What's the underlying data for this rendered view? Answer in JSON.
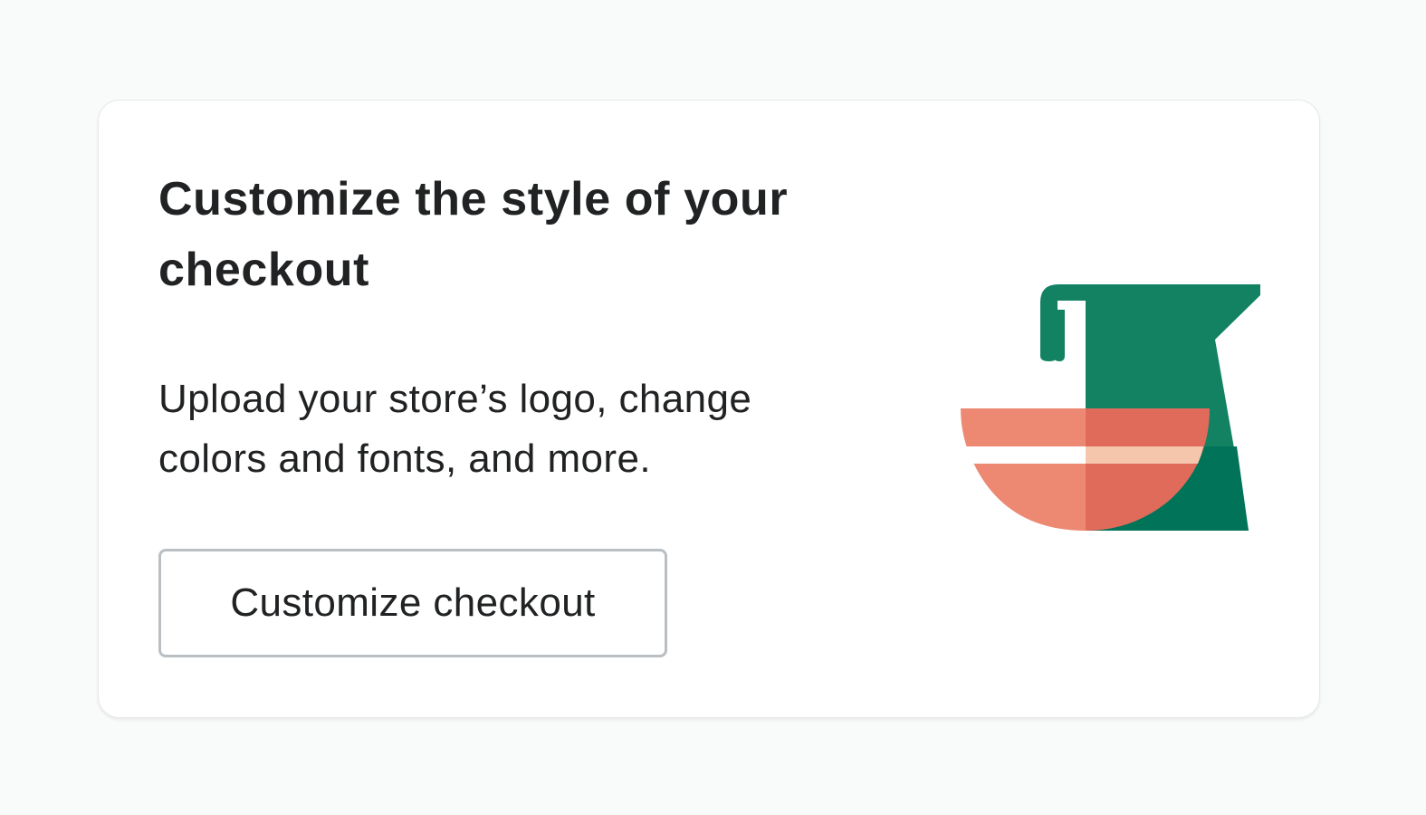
{
  "card": {
    "title": "Customize the style of your checkout",
    "description": "Upload your store’s logo, change colors and fonts, and more.",
    "button_label": "Customize checkout"
  },
  "illustration": {
    "icon": "mixing-bowl-pitcher-illustration",
    "colors": {
      "pitcher": "#128262",
      "pitcher_shadow": "#007359",
      "bowl": "#ed8972",
      "bowl_shadow": "#e06b5b",
      "stripe": "#ffffff",
      "stripe_shadow": "#f5c6ab"
    }
  }
}
